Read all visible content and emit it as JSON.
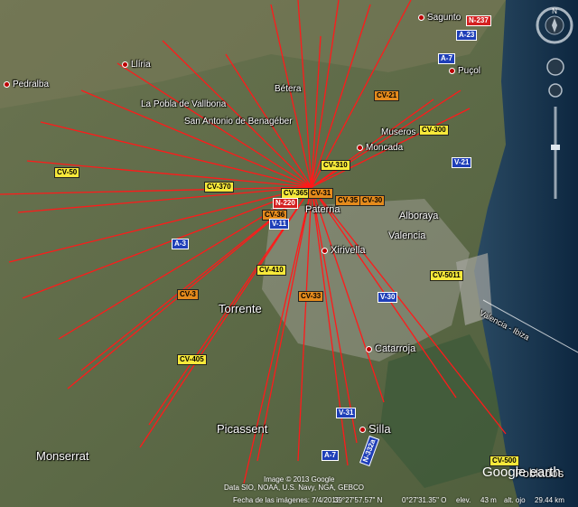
{
  "places": [
    {
      "id": "pedralba",
      "name": "Pedralba",
      "size": "small"
    },
    {
      "id": "lliria",
      "name": "Llíria",
      "size": "small"
    },
    {
      "id": "betera",
      "name": "Bétera",
      "size": "small"
    },
    {
      "id": "sagunto",
      "name": "Sagunto",
      "size": "small"
    },
    {
      "id": "pucol",
      "name": "Puçol",
      "size": "small"
    },
    {
      "id": "pobla",
      "name": "La Pobla de Vallbona",
      "size": "small"
    },
    {
      "id": "san-antonio",
      "name": "San Antonio de Benagéber",
      "size": "small"
    },
    {
      "id": "museros",
      "name": "Museros",
      "size": "small"
    },
    {
      "id": "moncada",
      "name": "Moncada",
      "size": "small"
    },
    {
      "id": "paterna",
      "name": "Paterna",
      "size": "med"
    },
    {
      "id": "alboraya",
      "name": "Alboraya",
      "size": "med"
    },
    {
      "id": "valencia",
      "name": "Valencia",
      "size": "med"
    },
    {
      "id": "xirivella",
      "name": "Xirivella",
      "size": "med"
    },
    {
      "id": "torrente",
      "name": "Torrente",
      "size": "big"
    },
    {
      "id": "catarroja",
      "name": "Catarroja",
      "size": "med"
    },
    {
      "id": "picassent",
      "name": "Picassent",
      "size": "big"
    },
    {
      "id": "silla",
      "name": "Silla",
      "size": "big"
    },
    {
      "id": "monserrat",
      "name": "Monserrat",
      "size": "big"
    },
    {
      "id": "pobla-farnals",
      "name": "Poblados",
      "size": "big"
    }
  ],
  "roads": [
    {
      "id": "cv-50",
      "label": "CV-50",
      "color": "yellow"
    },
    {
      "id": "cv-370",
      "label": "CV-370",
      "color": "yellow"
    },
    {
      "id": "cv-310",
      "label": "CV-310",
      "color": "yellow"
    },
    {
      "id": "cv-300",
      "label": "CV-300",
      "color": "yellow"
    },
    {
      "id": "cv-365",
      "label": "CV-365",
      "color": "yellow"
    },
    {
      "id": "cv-31",
      "label": "CV-31",
      "color": "orange"
    },
    {
      "id": "cv-35",
      "label": "CV-35",
      "color": "orange"
    },
    {
      "id": "cv-30",
      "label": "CV-30",
      "color": "orange"
    },
    {
      "id": "cv-36",
      "label": "CV-36",
      "color": "orange"
    },
    {
      "id": "cv-33",
      "label": "CV-33",
      "color": "orange"
    },
    {
      "id": "cv-3",
      "label": "CV-3",
      "color": "orange"
    },
    {
      "id": "n-220",
      "label": "N-220",
      "color": "red"
    },
    {
      "id": "v-11",
      "label": "V-11",
      "color": "blue"
    },
    {
      "id": "a-3",
      "label": "A-3",
      "color": "blue"
    },
    {
      "id": "cv-410",
      "label": "CV-410",
      "color": "yellow"
    },
    {
      "id": "cv-405",
      "label": "CV-405",
      "color": "yellow"
    },
    {
      "id": "v-30",
      "label": "V-30",
      "color": "blue"
    },
    {
      "id": "v-31",
      "label": "V-31",
      "color": "blue"
    },
    {
      "id": "a-7",
      "label": "A-7",
      "color": "blue"
    },
    {
      "id": "a-7-north",
      "label": "A-7",
      "color": "blue"
    },
    {
      "id": "v-21",
      "label": "V-21",
      "color": "blue"
    },
    {
      "id": "a-23",
      "label": "A-23",
      "color": "blue"
    },
    {
      "id": "n-237",
      "label": "N-237",
      "color": "red"
    },
    {
      "id": "cv-5011",
      "label": "CV-5011",
      "color": "yellow"
    },
    {
      "id": "cv-500",
      "label": "CV-500",
      "color": "yellow"
    },
    {
      "id": "n-332a",
      "label": "N-332a",
      "color": "blue"
    },
    {
      "id": "cv-21",
      "label": "CV-21",
      "color": "orange"
    }
  ],
  "ferry": "Valencia - Ibiza",
  "footer": {
    "copyright1": "Image © 2013 Google",
    "copyright2": "Data SIO, NOAA, U.S. Navy, NGA, GEBCO",
    "imagery_date": "Fecha de las imágenes: 7/4/2012",
    "lat": "39°27'57.57\" N",
    "lon": "0°27'31.35\" O",
    "elev_label": "elev.",
    "elev": "43 m",
    "alt_label": "alt. ojo",
    "alt": "29.44 km"
  },
  "logo": "Google earth",
  "compass_n": "N",
  "colors": {
    "rays": "#ff1a1a",
    "sea": "#0e2a44",
    "land": "#5b6b45"
  }
}
